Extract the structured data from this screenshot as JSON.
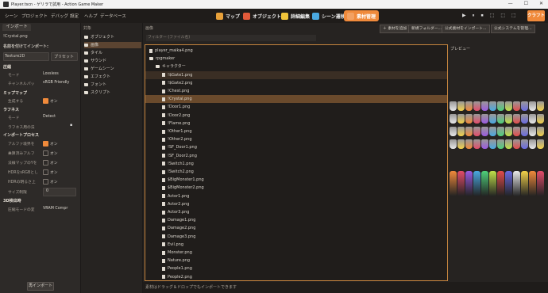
{
  "window": {
    "title": "Player.tscn - ゲリラで試用 - Action Game Maker",
    "controls": [
      "—",
      "☐",
      "✕"
    ]
  },
  "menubar": {
    "items": [
      "シーン",
      "プロジェクト",
      "デバッグ",
      "設定",
      "ヘルプ",
      "データベース"
    ]
  },
  "nav": {
    "buttons": [
      {
        "label": "マップ",
        "color": "#e8a13a"
      },
      {
        "label": "オブジェクト",
        "color": "#e25a3a"
      },
      {
        "label": "詳細編集",
        "color": "#f0c43a"
      },
      {
        "label": "シーン遷移",
        "color": "#4aa8e0"
      },
      {
        "label": "素材管理",
        "color": "#f08a3b",
        "active": true
      }
    ],
    "run": [
      "▶",
      "⏸",
      "⏹",
      "⬚",
      "⬚",
      "⬚",
      "⬚"
    ],
    "craft": "クラフト"
  },
  "import_panel": {
    "tab": "インポート",
    "file": "!Crystal.png",
    "preset_label": "名前を付けてインポート:",
    "type": "Texture2D",
    "preset_button": "プリセット",
    "sections": {
      "compress": {
        "title": "圧縮",
        "mode_label": "モード",
        "mode_value": "Lossless",
        "channel_label": "チャンネルパッ",
        "channel_value": "sRGB Friendly"
      },
      "mipmap": {
        "title": "ミップマップ",
        "generate_label": "生成する",
        "generate_value": "オン"
      },
      "roughness": {
        "title": "ラフネス",
        "mode_label": "モード",
        "mode_value": "Detect",
        "src_label": "ラフネス用の法"
      },
      "process": {
        "title": "インポートプロセス",
        "rows": [
          {
            "label": "アルファ境界を",
            "value": "オン",
            "on": true
          },
          {
            "label": "乗算済みアルフ",
            "value": "オン",
            "on": false
          },
          {
            "label": "法線マップのYを",
            "value": "オン",
            "on": false
          },
          {
            "label": "HDRをsRGBとし",
            "value": "オン",
            "on": false
          },
          {
            "label": "HDRの明るさ上",
            "value": "オン",
            "on": false
          }
        ],
        "size_label": "サイズ制限",
        "size_value": "0"
      },
      "detect3d": {
        "title": "3D検出時",
        "compress_label": "圧縮モードの変",
        "compress_value": "VRAM Compr"
      }
    },
    "reimport": "再インポート"
  },
  "folders": {
    "header": "対象",
    "items": [
      {
        "label": "オブジェクト",
        "selected": false
      },
      {
        "label": "画像",
        "selected": true
      },
      {
        "label": "タイル",
        "selected": false
      },
      {
        "label": "サウンド",
        "selected": false
      },
      {
        "label": "ゲームシーン",
        "selected": false
      },
      {
        "label": "エフェクト",
        "selected": false
      },
      {
        "label": "フォント",
        "selected": false
      },
      {
        "label": "スクリプト",
        "selected": false
      }
    ]
  },
  "main": {
    "header": "画像",
    "filter_placeholder": "フィルター (ファイル名)",
    "buttons": [
      "＋ 素材を追加",
      "新規フォルダー...",
      "公式素材をインポート...",
      "公式システムを管理..."
    ],
    "preview_label": "プレビュー",
    "status": "素材はドラッグ＆ドロップでもインポートできます",
    "tree": [
      {
        "label": "player_maika4.png",
        "indent": 0,
        "kind": "file"
      },
      {
        "label": "rpgmaker",
        "indent": 0,
        "kind": "folder"
      },
      {
        "label": "キャラクター",
        "indent": 1,
        "kind": "folder"
      },
      {
        "label": "!$Gate1.png",
        "indent": 2,
        "kind": "file",
        "state": "hl"
      },
      {
        "label": "!$Gate2.png",
        "indent": 2,
        "kind": "file"
      },
      {
        "label": "!Chest.png",
        "indent": 2,
        "kind": "file"
      },
      {
        "label": "!Crystal.png",
        "indent": 2,
        "kind": "file",
        "state": "sel"
      },
      {
        "label": "!Door1.png",
        "indent": 2,
        "kind": "file"
      },
      {
        "label": "!Door2.png",
        "indent": 2,
        "kind": "file"
      },
      {
        "label": "!Flame.png",
        "indent": 2,
        "kind": "file"
      },
      {
        "label": "!Other1.png",
        "indent": 2,
        "kind": "file"
      },
      {
        "label": "!Other2.png",
        "indent": 2,
        "kind": "file"
      },
      {
        "label": "!SF_Door1.png",
        "indent": 2,
        "kind": "file"
      },
      {
        "label": "!SF_Door2.png",
        "indent": 2,
        "kind": "file"
      },
      {
        "label": "!Switch1.png",
        "indent": 2,
        "kind": "file"
      },
      {
        "label": "!Switch2.png",
        "indent": 2,
        "kind": "file"
      },
      {
        "label": "$BigMonster1.png",
        "indent": 2,
        "kind": "file"
      },
      {
        "label": "$BigMonster2.png",
        "indent": 2,
        "kind": "file"
      },
      {
        "label": "Actor1.png",
        "indent": 2,
        "kind": "file"
      },
      {
        "label": "Actor2.png",
        "indent": 2,
        "kind": "file"
      },
      {
        "label": "Actor3.png",
        "indent": 2,
        "kind": "file"
      },
      {
        "label": "Damage1.png",
        "indent": 2,
        "kind": "file"
      },
      {
        "label": "Damage2.png",
        "indent": 2,
        "kind": "file"
      },
      {
        "label": "Damage3.png",
        "indent": 2,
        "kind": "file"
      },
      {
        "label": "Evil.png",
        "indent": 2,
        "kind": "file"
      },
      {
        "label": "Monster.png",
        "indent": 2,
        "kind": "file"
      },
      {
        "label": "Nature.png",
        "indent": 2,
        "kind": "file"
      },
      {
        "label": "People1.png",
        "indent": 2,
        "kind": "file"
      },
      {
        "label": "People2.png",
        "indent": 2,
        "kind": "file"
      }
    ]
  },
  "gem_colors": [
    "#e9e9e9",
    "#f2d14a",
    "#f08a3b",
    "#e24c6a",
    "#9a5ae0",
    "#4aa8e0",
    "#4fcf7a",
    "#bfe04a",
    "#e24c4c",
    "#6a6ae0"
  ]
}
